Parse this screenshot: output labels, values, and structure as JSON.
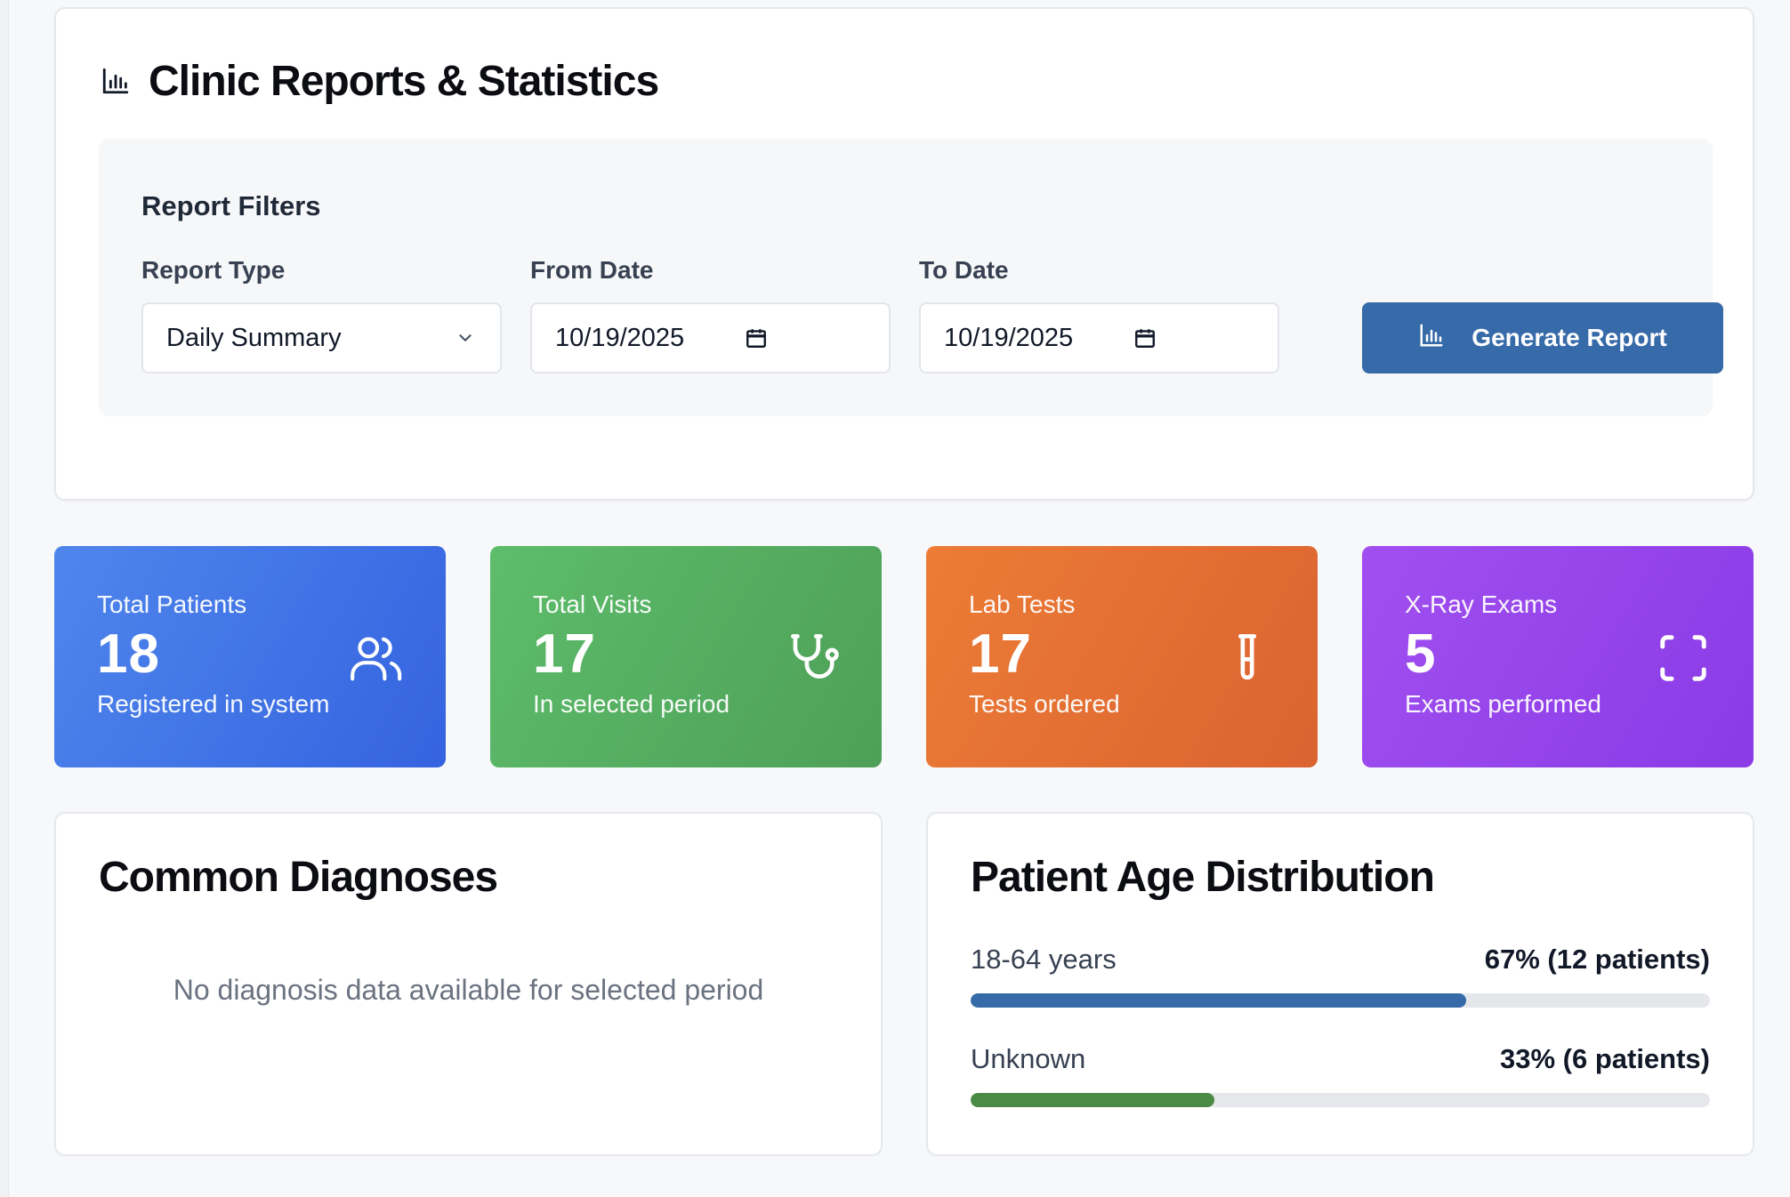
{
  "header": {
    "title": "Clinic Reports & Statistics",
    "icon": "bar-chart-icon"
  },
  "filters": {
    "title": "Report Filters",
    "report_type": {
      "label": "Report Type",
      "value": "Daily Summary"
    },
    "from_date": {
      "label": "From Date",
      "value": "10/19/2025"
    },
    "to_date": {
      "label": "To Date",
      "value": "10/19/2025"
    },
    "generate_label": "Generate Report"
  },
  "stats": [
    {
      "label": "Total Patients",
      "value": "18",
      "sub": "Registered in system",
      "icon": "users-icon",
      "color": "#3f72e6"
    },
    {
      "label": "Total Visits",
      "value": "17",
      "sub": "In selected period",
      "icon": "stethoscope-icon",
      "color": "#56ad61"
    },
    {
      "label": "Lab Tests",
      "value": "17",
      "sub": "Tests ordered",
      "icon": "test-tube-icon",
      "color": "#e46f33"
    },
    {
      "label": "X-Ray Exams",
      "value": "5",
      "sub": "Exams performed",
      "icon": "scan-icon",
      "color": "#9546eb"
    }
  ],
  "diagnoses": {
    "title": "Common Diagnoses",
    "empty_message": "No diagnosis data available for selected period"
  },
  "age_distribution": {
    "title": "Patient Age Distribution",
    "rows": [
      {
        "label": "18-64 years",
        "value_text": "67% (12 patients)",
        "percent": 67,
        "color": "#376aa8"
      },
      {
        "label": "Unknown",
        "value_text": "33% (6 patients)",
        "percent": 33,
        "color": "#4b8a44"
      }
    ]
  }
}
